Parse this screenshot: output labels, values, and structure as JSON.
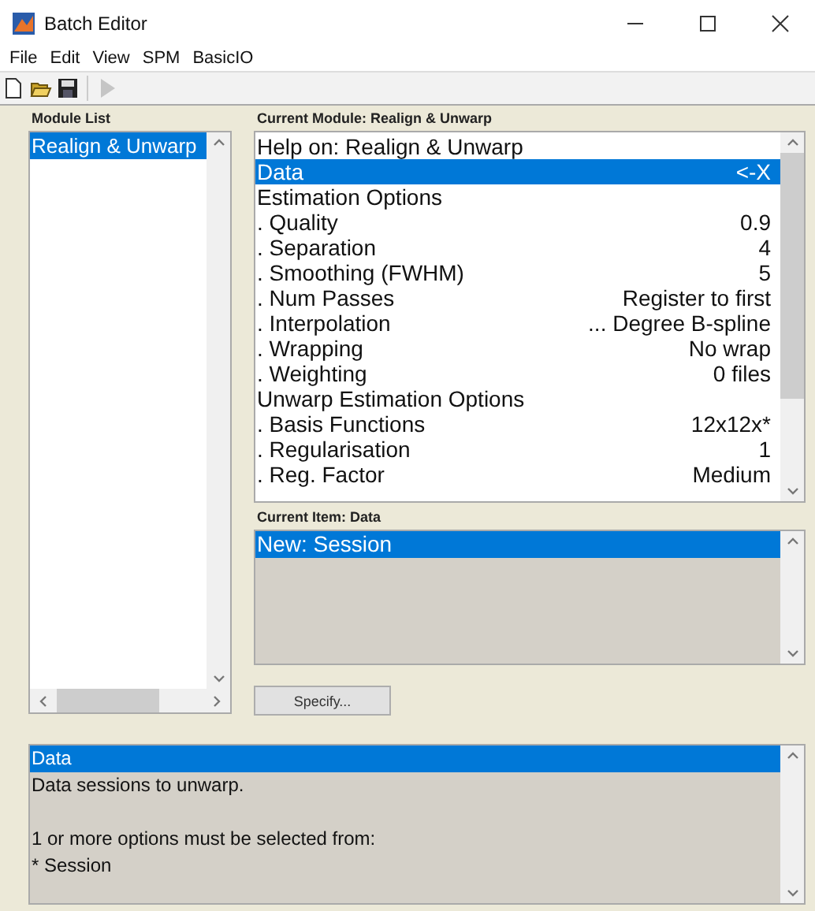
{
  "window": {
    "title": "Batch Editor"
  },
  "menu": [
    "File",
    "Edit",
    "View",
    "SPM",
    "BasicIO"
  ],
  "toolbar": [
    {
      "kind": "new",
      "disabled": false
    },
    {
      "kind": "open",
      "disabled": false
    },
    {
      "kind": "save",
      "disabled": false
    },
    {
      "kind": "run",
      "disabled": true
    }
  ],
  "module_list": {
    "label": "Module List",
    "items": [
      {
        "text": "Realign & Unwarp",
        "selected": true
      }
    ]
  },
  "current_module": {
    "label": "Current Module: Realign & Unwarp",
    "rows": [
      {
        "kind": "header",
        "label": "Help on: Realign & Unwarp",
        "selected": false
      },
      {
        "kind": "option",
        "label": "Data",
        "value": "<-X",
        "selected": true
      },
      {
        "kind": "header",
        "label": "Estimation Options",
        "selected": false
      },
      {
        "kind": "option",
        "label": ". Quality",
        "value": "0.9",
        "selected": false
      },
      {
        "kind": "option",
        "label": ". Separation",
        "value": "4",
        "selected": false
      },
      {
        "kind": "option",
        "label": ". Smoothing (FWHM)",
        "value": "5",
        "selected": false
      },
      {
        "kind": "option",
        "label": ". Num Passes",
        "value": "Register to first",
        "selected": false
      },
      {
        "kind": "option",
        "label": ". Interpolation",
        "value": "... Degree B-spline",
        "selected": false
      },
      {
        "kind": "option",
        "label": ". Wrapping",
        "value": "No wrap",
        "selected": false
      },
      {
        "kind": "option",
        "label": ". Weighting",
        "value": "0 files",
        "selected": false
      },
      {
        "kind": "header",
        "label": "Unwarp Estimation Options",
        "selected": false
      },
      {
        "kind": "option",
        "label": ". Basis Functions",
        "value": "12x12x*",
        "selected": false
      },
      {
        "kind": "option",
        "label": ". Regularisation",
        "value": "1",
        "selected": false
      },
      {
        "kind": "option",
        "label": ". Reg. Factor",
        "value": "Medium",
        "selected": false
      }
    ]
  },
  "current_item": {
    "label": "Current Item: Data",
    "items": [
      {
        "text": "New: Session",
        "selected": true
      }
    ]
  },
  "specify_button": "Specify...",
  "help": {
    "lines": [
      {
        "text": "Data",
        "selected": true,
        "gap_before": false
      },
      {
        "text": "Data sessions to unwarp.",
        "selected": false,
        "gap_before": false
      },
      {
        "text": "1 or more options must be selected from:",
        "selected": false,
        "gap_before": true
      },
      {
        "text": "* Session",
        "selected": false,
        "gap_before": false
      }
    ]
  }
}
